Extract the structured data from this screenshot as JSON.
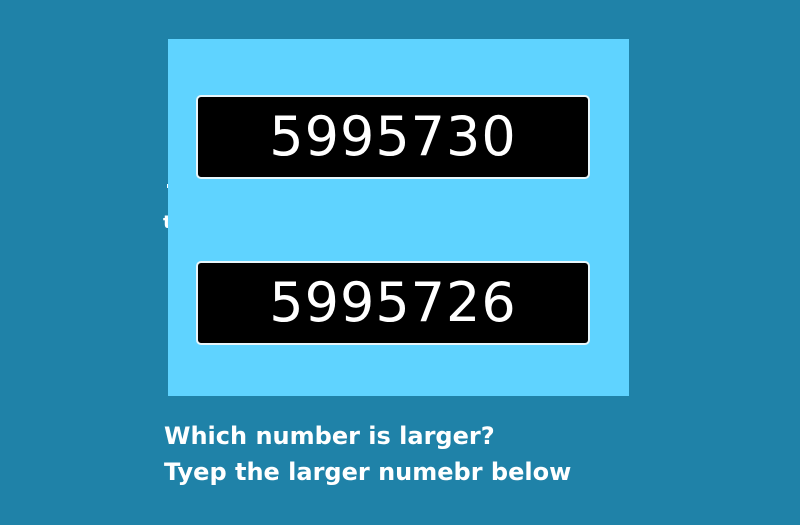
{
  "numbers": {
    "first": "5995730",
    "second": "5995726"
  },
  "fragment": {
    "text": "te"
  },
  "prompt": {
    "line1": "Which number is larger?",
    "line2": "Tyep the larger numebr below"
  },
  "colors": {
    "background": "#1f82a8",
    "panel": "#5fd3ff",
    "box": "#000000",
    "text": "#ffffff"
  }
}
